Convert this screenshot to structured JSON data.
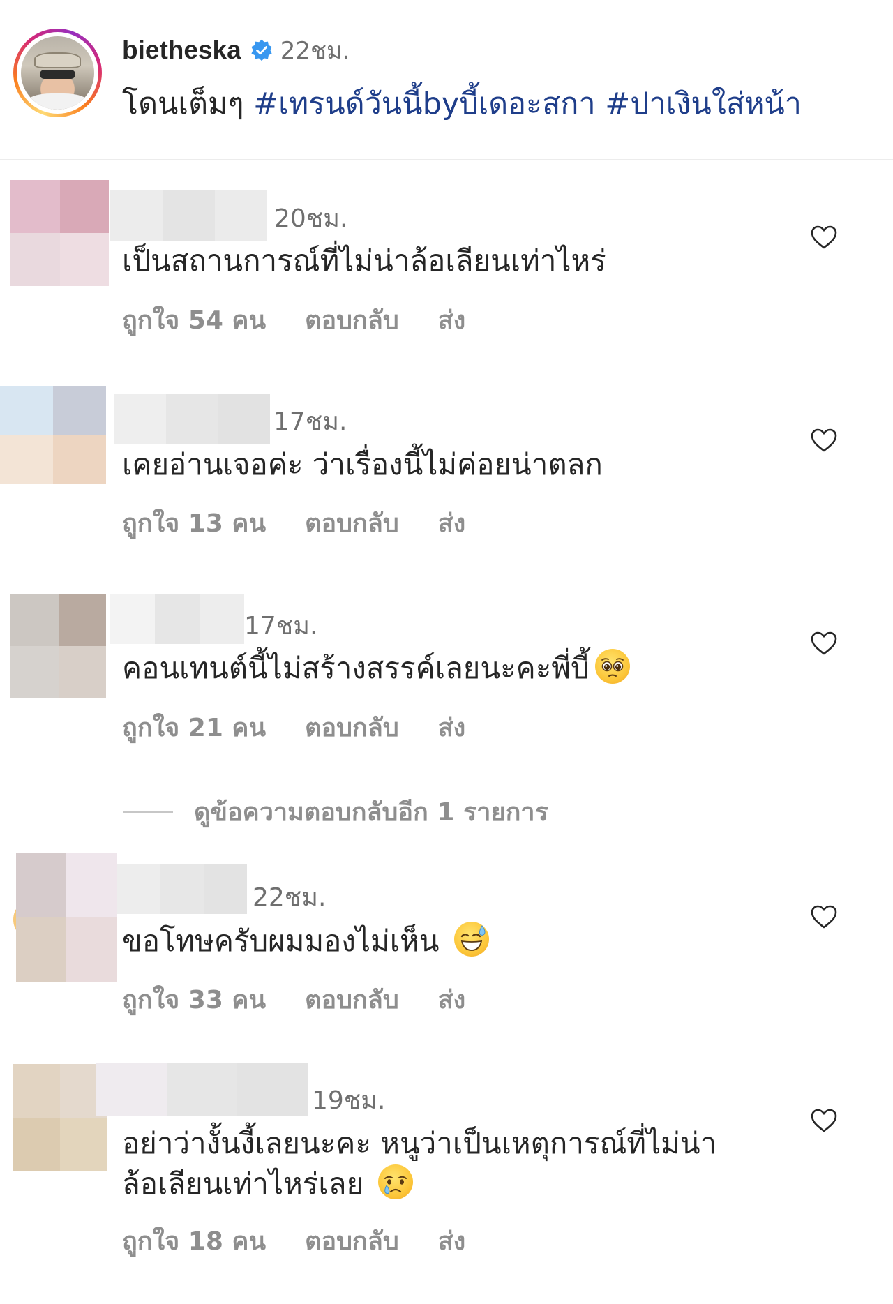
{
  "post": {
    "username": "bietheska",
    "time": "22ชม.",
    "caption_text": "โดนเต็มๆ ",
    "hashtag_1": "#เทรนด์วันนี้byบี้เดอะสกา",
    "hashtag_2": "#ปาเงินใส่หน้า"
  },
  "comments": [
    {
      "time": "20ชม.",
      "text_line_1": "เป็นสถานการณ์ที่ไม่น่าล้อเลียนเท่าไหร่",
      "likes": "ถูกใจ 54 คน",
      "reply": "ตอบกลับ",
      "send": "ส่ง",
      "avatar_colors": [
        "#e3bccb",
        "#d9a9b7",
        "#e9d9de",
        "#eedde2"
      ],
      "name_colors": [
        "#ececec",
        "#e4e4e4",
        "#ebebeb"
      ]
    },
    {
      "time": "17ชม.",
      "text_line_1": "เคยอ่านเจอค่ะ ว่าเรื่องนี้ไม่ค่อยน่าตลก",
      "likes": "ถูกใจ 13 คน",
      "reply": "ตอบกลับ",
      "send": "ส่ง",
      "avatar_colors": [
        "#d8e6f2",
        "#c8ccd8",
        "#f3e4d6",
        "#edd5c1"
      ],
      "name_colors": [
        "#eeeeee",
        "#e6e6e6",
        "#e2e2e2"
      ]
    },
    {
      "time": "17ชม.",
      "text_line_1": "คอนเทนต์นี้ไม่สร้างสรรค์เลยนะคะพี่บี้",
      "emoji": "pleading-face",
      "likes": "ถูกใจ 21 คน",
      "reply": "ตอบกลับ",
      "send": "ส่ง",
      "avatar_colors": [
        "#ccc7c2",
        "#b9aaa0",
        "#d6d2ce",
        "#d8cfc8"
      ],
      "name_colors": [
        "#f3f3f3",
        "#e6e6e6",
        "#ededed"
      ]
    },
    {
      "time": "22ชม.",
      "text_line_1": "ขอโทษครับผมมองไม่เห็น",
      "emoji": "grinning-face-with-sweat",
      "likes": "ถูกใจ 33 คน",
      "reply": "ตอบกลับ",
      "send": "ส่ง",
      "avatar_colors": [
        "#d6cbcc",
        "#efe6ec",
        "#dccfc3",
        "#e9dbdc"
      ],
      "name_colors": [
        "#ededed",
        "#e7e7e7",
        "#e3e3e3"
      ]
    },
    {
      "time": "19ชม.",
      "text_line_1": "อย่าว่างั้นงี้เลยนะคะ หนูว่าเป็นเหตุการณ์ที่ไม่น่า",
      "text_line_2": "ล้อเลียนเท่าไหร่เลย",
      "emoji": "crying-face",
      "likes": "ถูกใจ 18 คน",
      "reply": "ตอบกลับ",
      "send": "ส่ง",
      "avatar_colors": [
        "#e2d4c2",
        "#e4d9cd",
        "#dccbb0",
        "#e3d5bc"
      ],
      "name_colors": [
        "#efebef",
        "#e6e6e6",
        "#e3e3e3"
      ]
    }
  ],
  "view_replies": "ดูข้อความตอบกลับอีก 1 รายการ",
  "icons": {
    "verified": "verified-badge-icon",
    "heart": "heart-outline-icon"
  },
  "colors": {
    "hashtag": "#1f3e8a",
    "verified": "#3897f0",
    "muted_text": "#8e8e8e"
  }
}
